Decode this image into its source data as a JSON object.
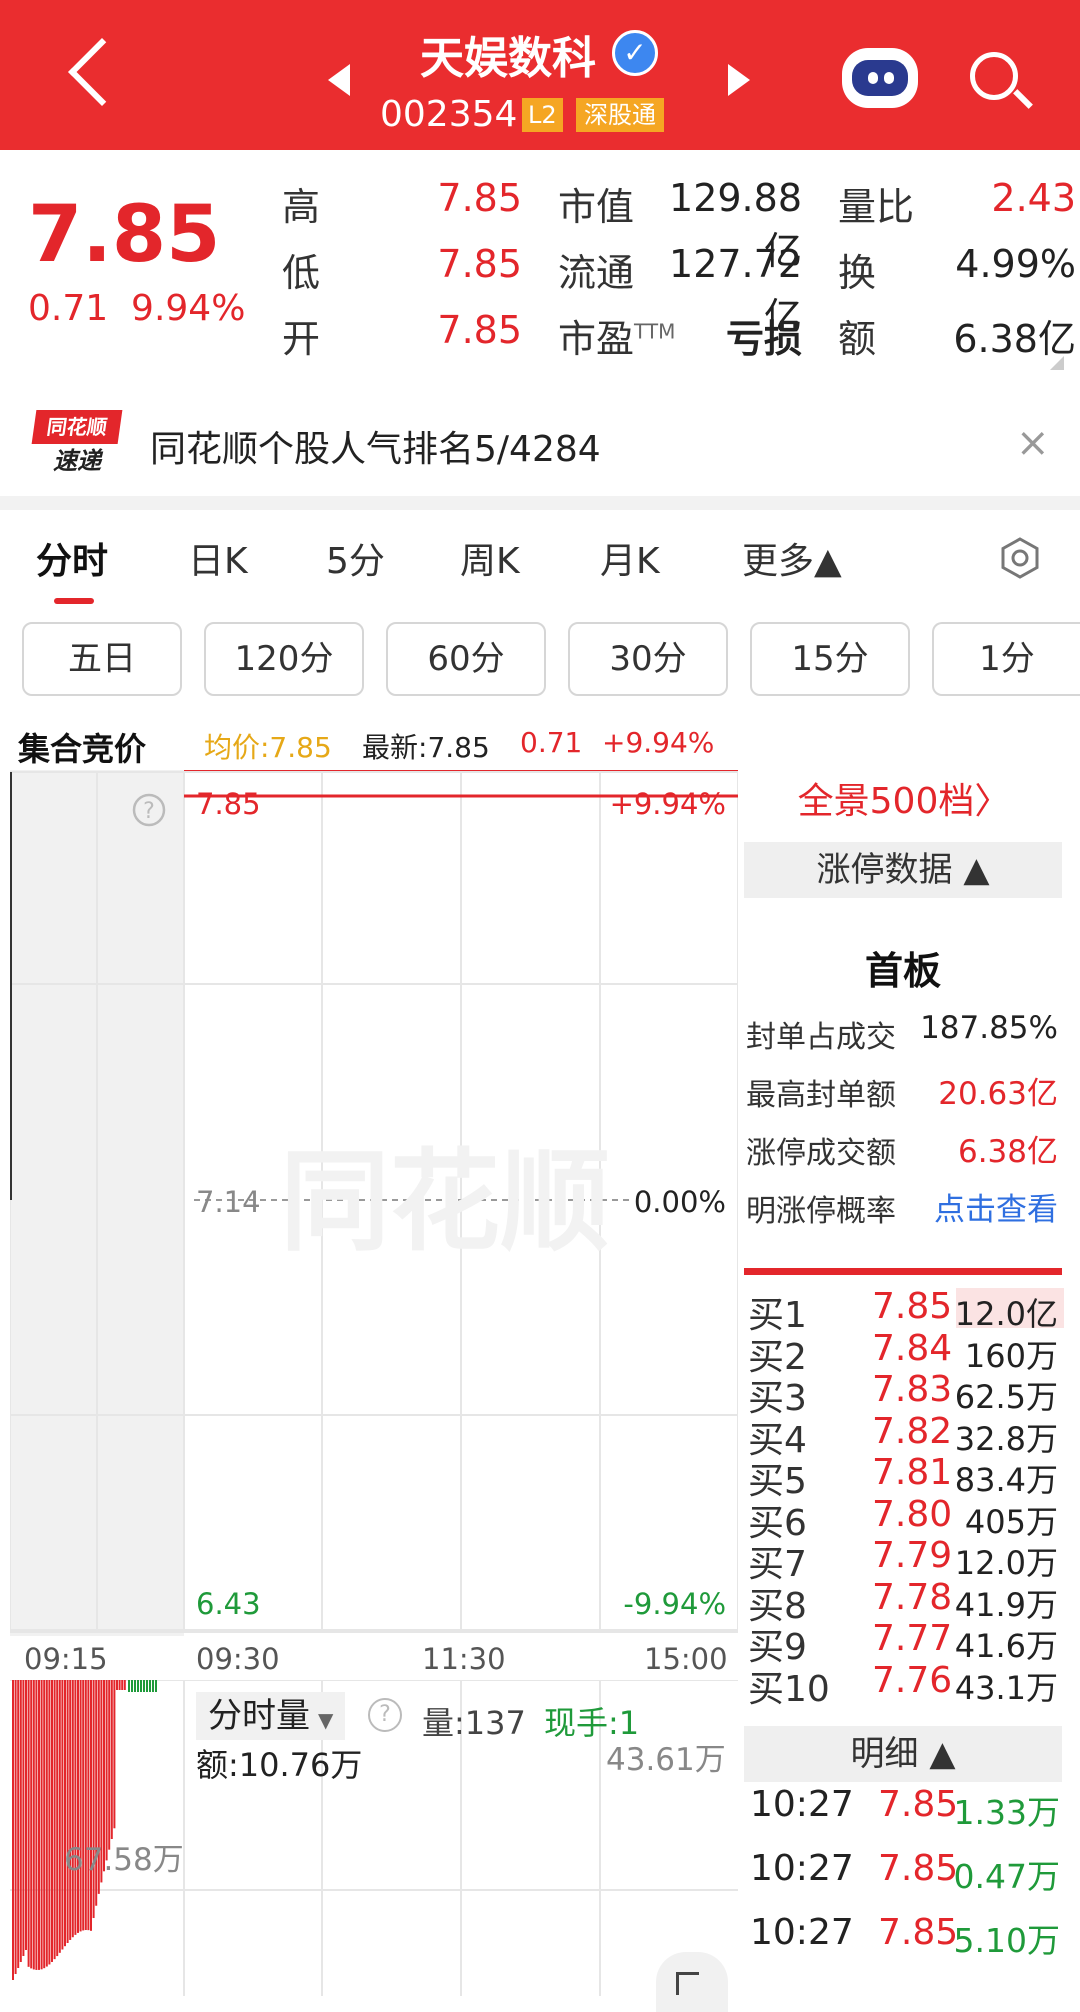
{
  "header": {
    "stock_name": "天娱数科",
    "verified_mark": "✓",
    "stock_code": "002354",
    "tag_l2": "L2",
    "tag_connect": "深股通"
  },
  "quote": {
    "price": "7.85",
    "change": "0.71",
    "change_pct": "9.94%",
    "rows": [
      {
        "l1": "高",
        "v1": "7.85",
        "l2": "市值",
        "v2": "129.88亿",
        "l3": "量比",
        "v3": "2.43"
      },
      {
        "l1": "低",
        "v1": "7.85",
        "l2": "流通",
        "v2": "127.72亿",
        "l3": "换",
        "v3": "4.99%"
      },
      {
        "l1": "开",
        "v1": "7.85",
        "l2": "市盈",
        "l2sup": "TTM",
        "v2": "亏损",
        "l3": "额",
        "v3": "6.38亿"
      }
    ]
  },
  "popularity": {
    "logo_top": "同花顺",
    "logo_bottom": "速递",
    "text": "同花顺个股人气排名5/4284",
    "close": "×"
  },
  "tabs": [
    "分时",
    "日K",
    "5分",
    "周K",
    "月K",
    "更多▲"
  ],
  "periods": [
    "五日",
    "120分",
    "60分",
    "30分",
    "15分",
    "1分"
  ],
  "info_bar": {
    "label": "集合竞价",
    "avg": "均价:7.85",
    "latest_label": "最新:",
    "latest": "7.85",
    "change": "0.71",
    "change_pct": "+9.94%"
  },
  "chart": {
    "help": "?",
    "price_top": "7.85",
    "pct_top": "+9.94%",
    "price_mid": "7.14",
    "pct_mid": "0.00%",
    "price_bot": "6.43",
    "pct_bot": "-9.94%",
    "watermark": "同花顺",
    "times": [
      "09:15",
      "09:30",
      "11:30",
      "15:00"
    ],
    "vol_label": "分时量",
    "vol_help": "?",
    "vol_amount": "量:137",
    "now_hand": "现手:1",
    "amount": "额:10.76万",
    "vol_max": "43.61万",
    "auction_max": "67.58万"
  },
  "chart_data": {
    "type": "line",
    "title": "",
    "xlabel": "",
    "ylabel": "",
    "x": [
      "09:30",
      "11:30",
      "15:00"
    ],
    "ylim": [
      6.43,
      7.85
    ],
    "series": [
      {
        "values": [
          7.85,
          7.85,
          7.85
        ]
      }
    ]
  },
  "right_panel": {
    "panorama": "全景500档〉",
    "limit_band": "涨停数据 ▲",
    "board": "首板",
    "stats": [
      {
        "label": "封单占成交",
        "value": "187.85%",
        "color": "dark"
      },
      {
        "label": "最高封单额",
        "value": "20.63亿",
        "color": "red"
      },
      {
        "label": "涨停成交额",
        "value": "6.38亿",
        "color": "red"
      },
      {
        "label": "明涨停概率",
        "value": "点击查看",
        "color": "blue"
      }
    ],
    "orderbook": [
      {
        "label": "买1",
        "price": "7.85",
        "vol": "12.0亿"
      },
      {
        "label": "买2",
        "price": "7.84",
        "vol": "160万"
      },
      {
        "label": "买3",
        "price": "7.83",
        "vol": "62.5万"
      },
      {
        "label": "买4",
        "price": "7.82",
        "vol": "32.8万"
      },
      {
        "label": "买5",
        "price": "7.81",
        "vol": "83.4万"
      },
      {
        "label": "买6",
        "price": "7.80",
        "vol": "405万"
      },
      {
        "label": "买7",
        "price": "7.79",
        "vol": "12.0万"
      },
      {
        "label": "买8",
        "price": "7.78",
        "vol": "41.9万"
      },
      {
        "label": "买9",
        "price": "7.77",
        "vol": "41.6万"
      },
      {
        "label": "买10",
        "price": "7.76",
        "vol": "43.1万"
      }
    ],
    "detail_band": "明细 ▲",
    "details": [
      {
        "time": "10:27",
        "price": "7.85",
        "vol": "1.33万"
      },
      {
        "time": "10:27",
        "price": "7.85",
        "vol": "0.47万"
      },
      {
        "time": "10:27",
        "price": "7.85",
        "vol": "5.10万"
      }
    ]
  },
  "colors": {
    "brand_red": "#ea2d2f",
    "rise": "#e3262b",
    "fall": "#1f9a3a",
    "avg": "#e6a817",
    "link": "#2f6fe0"
  }
}
